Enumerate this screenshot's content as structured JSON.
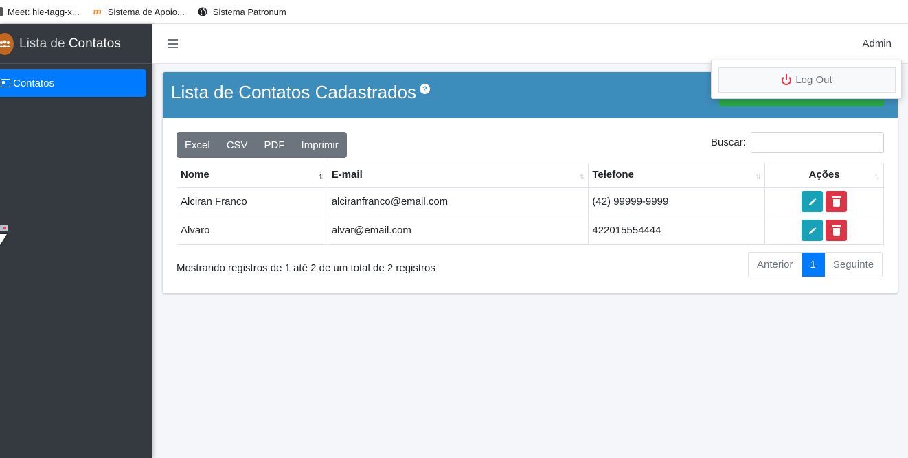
{
  "bookmarks": [
    {
      "label": "Meet: hie-tagg-x...",
      "icon": "meet-icon"
    },
    {
      "label": "Sistema de Apoio...",
      "icon": "moodle-icon"
    },
    {
      "label": "Sistema Patronum",
      "icon": "globe-icon"
    }
  ],
  "sidebar": {
    "brand_prefix": "Lista de ",
    "brand_strong": "Contatos",
    "items": [
      {
        "label": "Contatos",
        "icon": "address-card-icon",
        "active": true
      }
    ]
  },
  "navbar": {
    "user": "Admin"
  },
  "dropdown": {
    "logout_label": "Log Out"
  },
  "card": {
    "title": "Lista de Contatos Cadastrados",
    "export_buttons": [
      "Excel",
      "CSV",
      "PDF",
      "Imprimir"
    ],
    "search_label": "Buscar:",
    "search_value": ""
  },
  "table": {
    "columns": [
      "Nome",
      "E-mail",
      "Telefone",
      "Ações"
    ],
    "rows": [
      {
        "nome": "Alciran Franco",
        "email": "alciranfranco@email.com",
        "telefone": "(42) 99999-9999"
      },
      {
        "nome": "Alvaro",
        "email": "alvar@email.com",
        "telefone": "422015554444"
      }
    ]
  },
  "footer": {
    "info": "Mostrando registros de 1 até 2 de um total de 2 registros",
    "pagination": {
      "previous": "Anterior",
      "current": "1",
      "next": "Seguinte"
    }
  },
  "colors": {
    "sidebar": "#343a40",
    "header": "#3c8dbc",
    "primary": "#007bff",
    "edit": "#17a2b8",
    "delete": "#dc3545",
    "success": "#28a745"
  }
}
